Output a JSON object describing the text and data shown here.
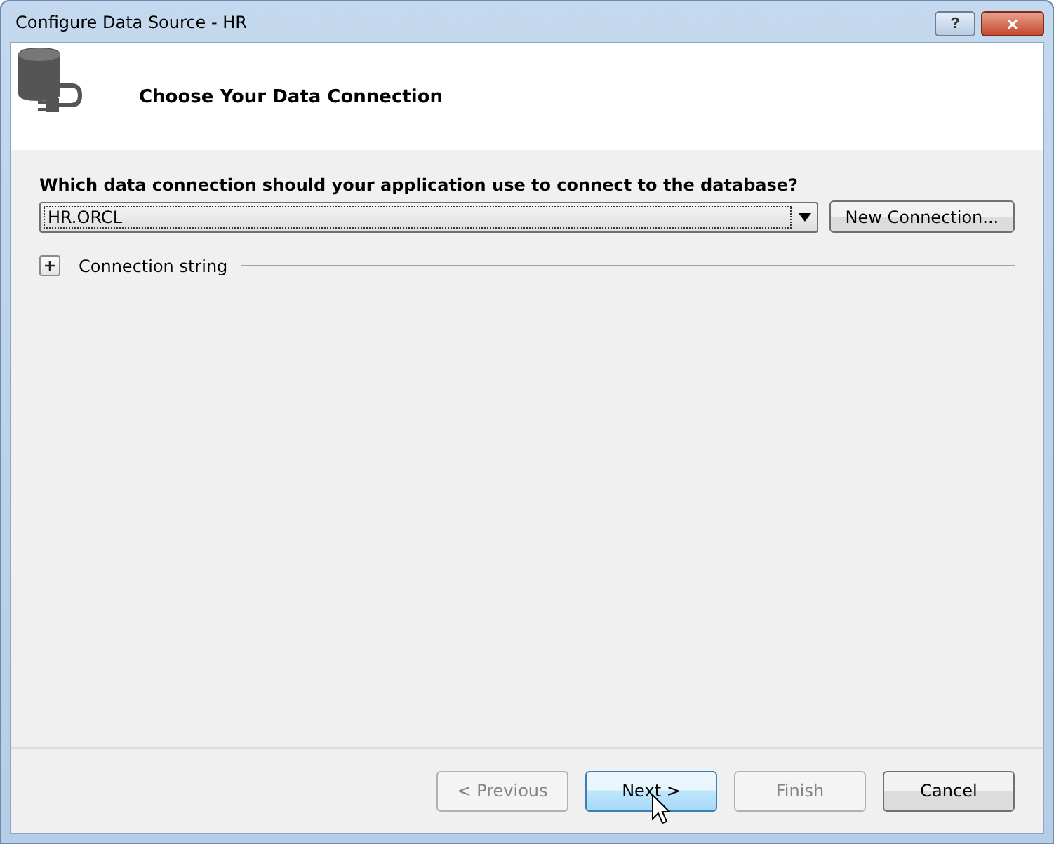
{
  "window": {
    "title": "Configure Data Source - HR",
    "controls": [
      "?",
      "×"
    ]
  },
  "header": {
    "title": "Choose Your Data Connection"
  },
  "prompt": "Which data connection should your application use to connect to the database?",
  "connection": {
    "value": "HR.ORCL",
    "button": "New Connection..."
  },
  "connection_string": {
    "label": "Connection string",
    "expanded": false
  },
  "buttons": [
    {
      "label": "< Previous",
      "disabled": true,
      "hovered": false
    },
    {
      "label": "Next >",
      "disabled": false,
      "hovered": true
    },
    {
      "label": "Finish",
      "disabled": true,
      "hovered": false
    },
    {
      "label": "Cancel",
      "disabled": false,
      "hovered": false
    }
  ]
}
